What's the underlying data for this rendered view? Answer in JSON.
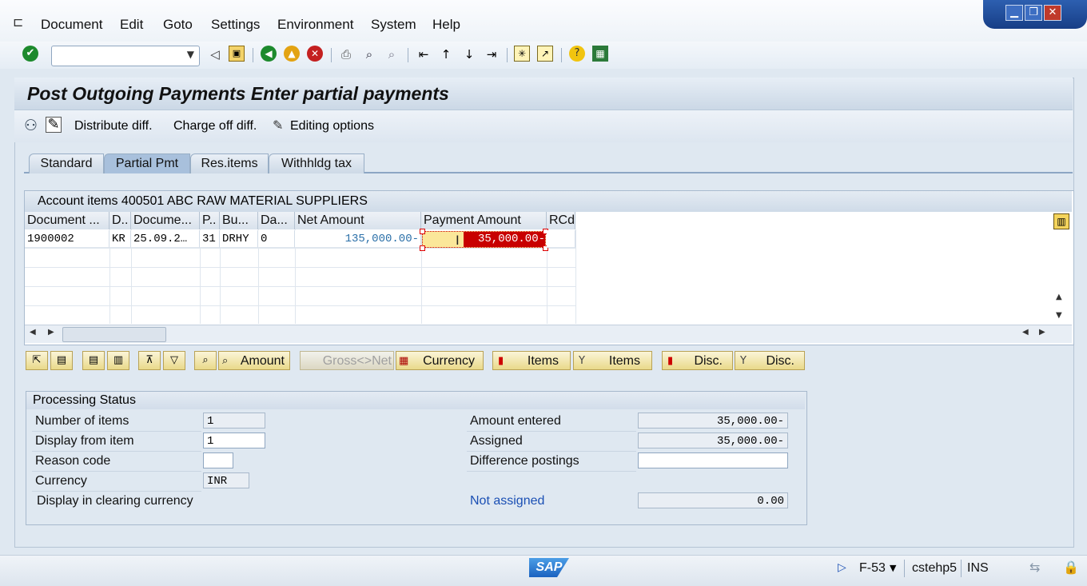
{
  "menu": {
    "items": [
      "Document",
      "Edit",
      "Goto",
      "Settings",
      "Environment",
      "System",
      "Help"
    ]
  },
  "window_controls": {
    "minimize": "▁",
    "restore": "❐",
    "close": "✕"
  },
  "toolbar": {
    "command_field_value": "",
    "icons": [
      "enter-icon",
      "back-icon",
      "save-icon",
      "back-nav-icon",
      "exit-icon",
      "cancel-icon",
      "print-icon",
      "find-icon",
      "find-next-icon",
      "first-page-icon",
      "prev-page-icon",
      "next-page-icon",
      "last-page-icon",
      "new-session-icon",
      "shortcut-icon",
      "help-icon",
      "layout-icon"
    ]
  },
  "screen": {
    "title": "Post Outgoing Payments Enter partial payments",
    "app_toolbar": {
      "distribute": "Distribute diff.",
      "charge_off": "Charge off diff.",
      "editing": "Editing options"
    }
  },
  "tabs": [
    {
      "label": "Standard"
    },
    {
      "label": "Partial Pmt"
    },
    {
      "label": "Res.items"
    },
    {
      "label": "Withhldg tax"
    }
  ],
  "table": {
    "header": "Account items 400501 ABC RAW MATERIAL SUPPLIERS",
    "columns": [
      "Document ...",
      "D..",
      "Docume...",
      "P..",
      "Bu...",
      "Da...",
      "Net Amount",
      "Payment Amount",
      "RCd"
    ],
    "rows": [
      {
        "doc": "1900002",
        "d": "KR",
        "date": "25.09.2…",
        "p": "31",
        "bu": "DRHY",
        "da": "0",
        "net": "135,000.00-",
        "payment": "35,000.00-",
        "rcd": ""
      }
    ]
  },
  "actions": {
    "amount": "Amount",
    "gross_net": "Gross<>Net",
    "currency": "Currency",
    "items1": "Items",
    "items2": "Items",
    "disc1": "Disc.",
    "disc2": "Disc."
  },
  "processing": {
    "header": "Processing Status",
    "number_of_items_label": "Number of items",
    "number_of_items": "1",
    "display_from_label": "Display from item",
    "display_from": "1",
    "reason_code_label": "Reason code",
    "reason_code": "",
    "currency_label": "Currency",
    "currency": "INR",
    "clearing_currency_label": "Display in clearing currency",
    "amount_entered_label": "Amount entered",
    "amount_entered": "35,000.00-",
    "assigned_label": "Assigned",
    "assigned": "35,000.00-",
    "difference_label": "Difference postings",
    "difference": "",
    "not_assigned_label": "Not assigned",
    "not_assigned": "0.00"
  },
  "status_bar": {
    "logo": "SAP",
    "transaction": "F-53",
    "server": "cstehp5",
    "mode": "INS"
  },
  "colors": {
    "accent": "#1a5cb0",
    "highlight_red": "#c80000",
    "highlight_yellow": "#fbe79a",
    "link_blue": "#1a4fb4",
    "net_amount_blue": "#2a6fa8"
  }
}
